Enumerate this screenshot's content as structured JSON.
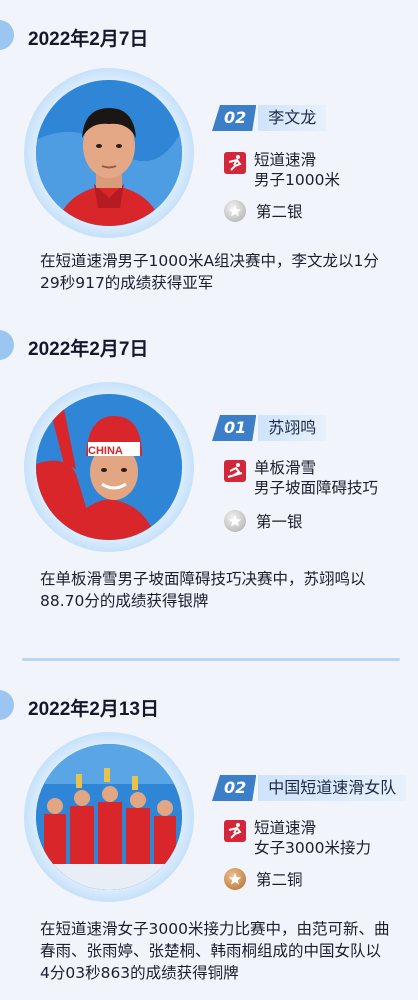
{
  "entries": [
    {
      "date": "2022年2月7日",
      "rank": "02",
      "athlete": "李文龙",
      "sport_line1": "短道速滑",
      "sport_line2": "男子1000米",
      "medal": "第二银",
      "medal_color": "#c9c9c9",
      "description": "在短道速滑男子1000米A组决赛中，李文龙以1分29秒917的成绩获得亚军"
    },
    {
      "date": "2022年2月7日",
      "rank": "01",
      "athlete": "苏翊鸣",
      "sport_line1": "单板滑雪",
      "sport_line2": "男子坡面障碍技巧",
      "medal": "第一银",
      "medal_color": "#c9c9c9",
      "description": "在单板滑雪男子坡面障碍技巧决赛中，苏翊鸣以88.70分的成绩获得银牌"
    },
    {
      "date": "2022年2月13日",
      "rank": "02",
      "athlete": "中国短道速滑女队",
      "sport_line1": "短道速滑",
      "sport_line2": "女子3000米接力",
      "medal": "第二铜",
      "medal_color": "#c8803e",
      "description": "在短道速滑女子3000米接力比赛中，由范可新、曲春雨、张雨婷、张楚桐、韩雨桐组成的中国女队以4分03秒863的成绩获得铜牌"
    }
  ],
  "photo_jersey": "CHINA"
}
